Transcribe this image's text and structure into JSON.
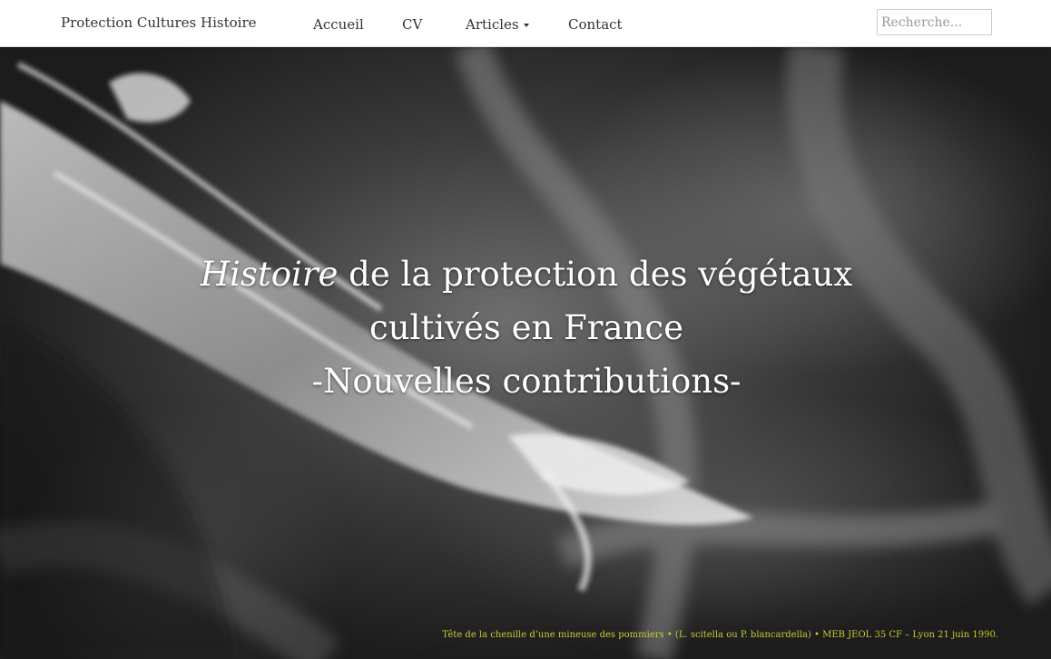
{
  "navbar": {
    "brand": "Protection Cultures Histoire",
    "items": [
      {
        "label": "Accueil"
      },
      {
        "label": "CV"
      },
      {
        "label": "Articles",
        "has_dropdown": true
      },
      {
        "label": "Contact"
      }
    ],
    "search": {
      "placeholder": "Recherche..."
    }
  },
  "hero": {
    "title_italic": "Histoire",
    "title_line1_rest": " de la protection des végétaux",
    "title_line2": "cultivés en France",
    "title_line3": "-Nouvelles contributions-",
    "caption": "Tête de la chenille d’une mineuse des pommiers • (L. scitella ou P. blancardella) • MEB JEOL 35 CF – Lyon 21 juin 1990."
  },
  "colors": {
    "navbar_bg": "#ffffff",
    "nav_text": "#333333",
    "hero_title": "#ffffff",
    "caption": "#c9c935"
  },
  "icons": [
    "caret-down-icon"
  ]
}
